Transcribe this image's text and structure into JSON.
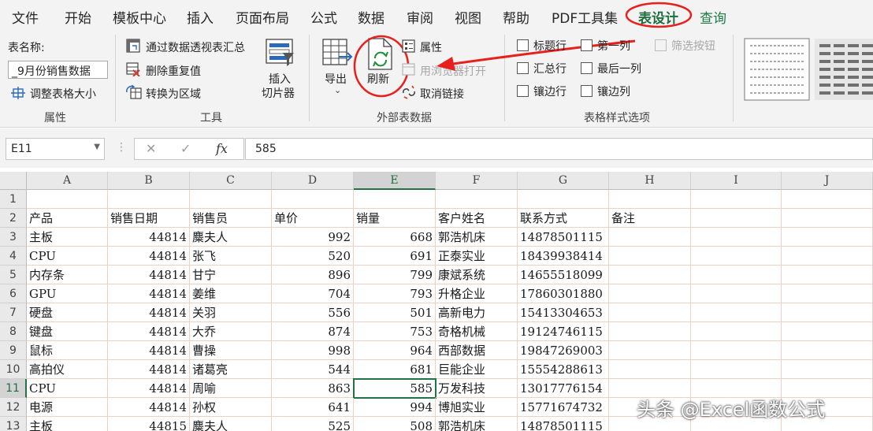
{
  "menu": {
    "tabs": [
      "文件",
      "开始",
      "模板中心",
      "插入",
      "页面布局",
      "公式",
      "数据",
      "审阅",
      "视图",
      "帮助",
      "PDF工具集",
      "表设计",
      "查询"
    ],
    "active_tab": "表设计"
  },
  "ribbon": {
    "properties_group": {
      "table_name_label": "表名称:",
      "table_name_value": "_9月份销售数据",
      "resize_label": "调整表格大小",
      "group_label": "属性"
    },
    "tools_group": {
      "pivot_label": "通过数据透视表汇总",
      "remove_dup_label": "删除重复值",
      "convert_label": "转换为区域",
      "slicer_label_1": "插入",
      "slicer_label_2": "切片器",
      "group_label": "工具"
    },
    "external_group": {
      "export_label": "导出",
      "refresh_label": "刷新",
      "properties_label": "属性",
      "open_browser_label": "用浏览器打开",
      "unlink_label": "取消链接",
      "group_label": "外部表数据"
    },
    "style_options_group": {
      "header_row": "标题行",
      "first_column": "第一列",
      "filter_button": "筛选按钮",
      "total_row": "汇总行",
      "last_column": "最后一列",
      "banded_rows": "镶边行",
      "banded_columns": "镶边列",
      "group_label": "表格样式选项",
      "header_row_checked": false,
      "first_column_checked": false,
      "filter_button_checked": false,
      "total_row_checked": false,
      "last_column_checked": false,
      "banded_rows_checked": false,
      "banded_columns_checked": false
    }
  },
  "formula_bar": {
    "name_box": "E11",
    "fx": "fx",
    "value": "585"
  },
  "sheet": {
    "columns": [
      "A",
      "B",
      "C",
      "D",
      "E",
      "F",
      "G",
      "H",
      "I",
      "J"
    ],
    "selected_column": "E",
    "selected_row": 11,
    "rows": [
      {
        "n": "1",
        "cells": [
          "",
          "",
          "",
          "",
          "",
          "",
          "",
          ""
        ]
      },
      {
        "n": "2",
        "cells": [
          "产品",
          "销售日期",
          "销售员",
          "单价",
          "销量",
          "客户姓名",
          "联系方式",
          "备注"
        ]
      },
      {
        "n": "3",
        "cells": [
          "主板",
          "44814",
          "麋夫人",
          "992",
          "668",
          "郭浩机床",
          "14878501115",
          ""
        ]
      },
      {
        "n": "4",
        "cells": [
          "CPU",
          "44814",
          "张飞",
          "520",
          "691",
          "正泰实业",
          "18439938414",
          ""
        ]
      },
      {
        "n": "5",
        "cells": [
          "内存条",
          "44814",
          "甘宁",
          "896",
          "799",
          "康斌系统",
          "14655518099",
          ""
        ]
      },
      {
        "n": "6",
        "cells": [
          "GPU",
          "44814",
          "姜维",
          "704",
          "793",
          "升格企业",
          "17860301880",
          ""
        ]
      },
      {
        "n": "7",
        "cells": [
          "硬盘",
          "44814",
          "关羽",
          "556",
          "501",
          "高新电力",
          "15413304653",
          ""
        ]
      },
      {
        "n": "8",
        "cells": [
          "键盘",
          "44814",
          "大乔",
          "874",
          "753",
          "奇格机械",
          "19124746115",
          ""
        ]
      },
      {
        "n": "9",
        "cells": [
          "鼠标",
          "44814",
          "曹操",
          "998",
          "964",
          "西部数据",
          "19847269003",
          ""
        ]
      },
      {
        "n": "10",
        "cells": [
          "高拍仪",
          "44814",
          "诸葛亮",
          "544",
          "681",
          "巨能企业",
          "15554288613",
          ""
        ]
      },
      {
        "n": "11",
        "cells": [
          "CPU",
          "44814",
          "周喻",
          "863",
          "585",
          "万发科技",
          "13017776154",
          ""
        ]
      },
      {
        "n": "12",
        "cells": [
          "电源",
          "44814",
          "孙权",
          "641",
          "994",
          "博旭实业",
          "15771674732",
          ""
        ]
      },
      {
        "n": "13",
        "cells": [
          "主板",
          "44815",
          "麋夫人",
          "525",
          "508",
          "郭浩机床",
          "14878501115",
          ""
        ]
      }
    ]
  },
  "watermark": "头条 @Excel函数公式",
  "colors": {
    "accent_green": "#217346",
    "annotation_red": "#e8201c"
  }
}
